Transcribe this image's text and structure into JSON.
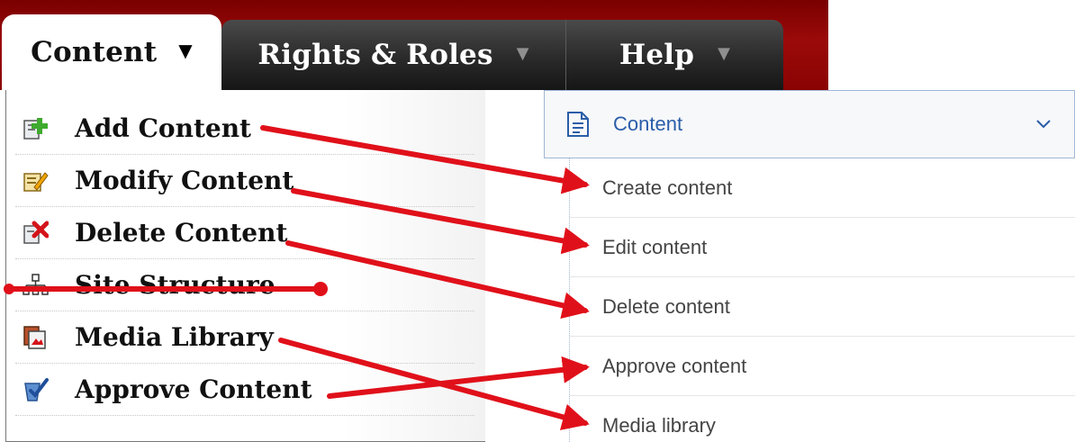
{
  "tabs": [
    {
      "label": "Content",
      "arrow": "▼"
    },
    {
      "label": "Rights & Roles",
      "arrow": "▼"
    },
    {
      "label": "Help",
      "arrow": "▼"
    }
  ],
  "old_menu": {
    "items": [
      {
        "label": "Add Content",
        "icon": "add-content-icon"
      },
      {
        "label": "Modify Content",
        "icon": "modify-content-icon"
      },
      {
        "label": "Delete Content",
        "icon": "delete-content-icon"
      },
      {
        "label": "Site Structure",
        "icon": "site-structure-icon",
        "struck_through": true
      },
      {
        "label": "Media Library",
        "icon": "media-library-icon"
      },
      {
        "label": "Approve Content",
        "icon": "approve-content-icon"
      }
    ]
  },
  "new_panel": {
    "header": {
      "title": "Content",
      "icon": "document-icon",
      "toggle_icon": "chevron-down-icon"
    },
    "items": [
      {
        "label": "Create content"
      },
      {
        "label": "Edit content"
      },
      {
        "label": "Delete content"
      },
      {
        "label": "Approve content"
      },
      {
        "label": "Media library"
      }
    ]
  },
  "colors": {
    "brand_red": "#8a0303",
    "tab_dark": "#2a2a2a",
    "link_blue": "#2a5da8",
    "annotation_red": "#e0101a"
  },
  "annotations": {
    "mapping": [
      {
        "from": "Add Content",
        "to": "Create content"
      },
      {
        "from": "Modify Content",
        "to": "Edit content"
      },
      {
        "from": "Delete Content",
        "to": "Delete content"
      },
      {
        "from": "Media Library",
        "to": "Media library"
      },
      {
        "from": "Approve Content",
        "to": "Approve content"
      }
    ],
    "removed": [
      "Site Structure"
    ]
  }
}
